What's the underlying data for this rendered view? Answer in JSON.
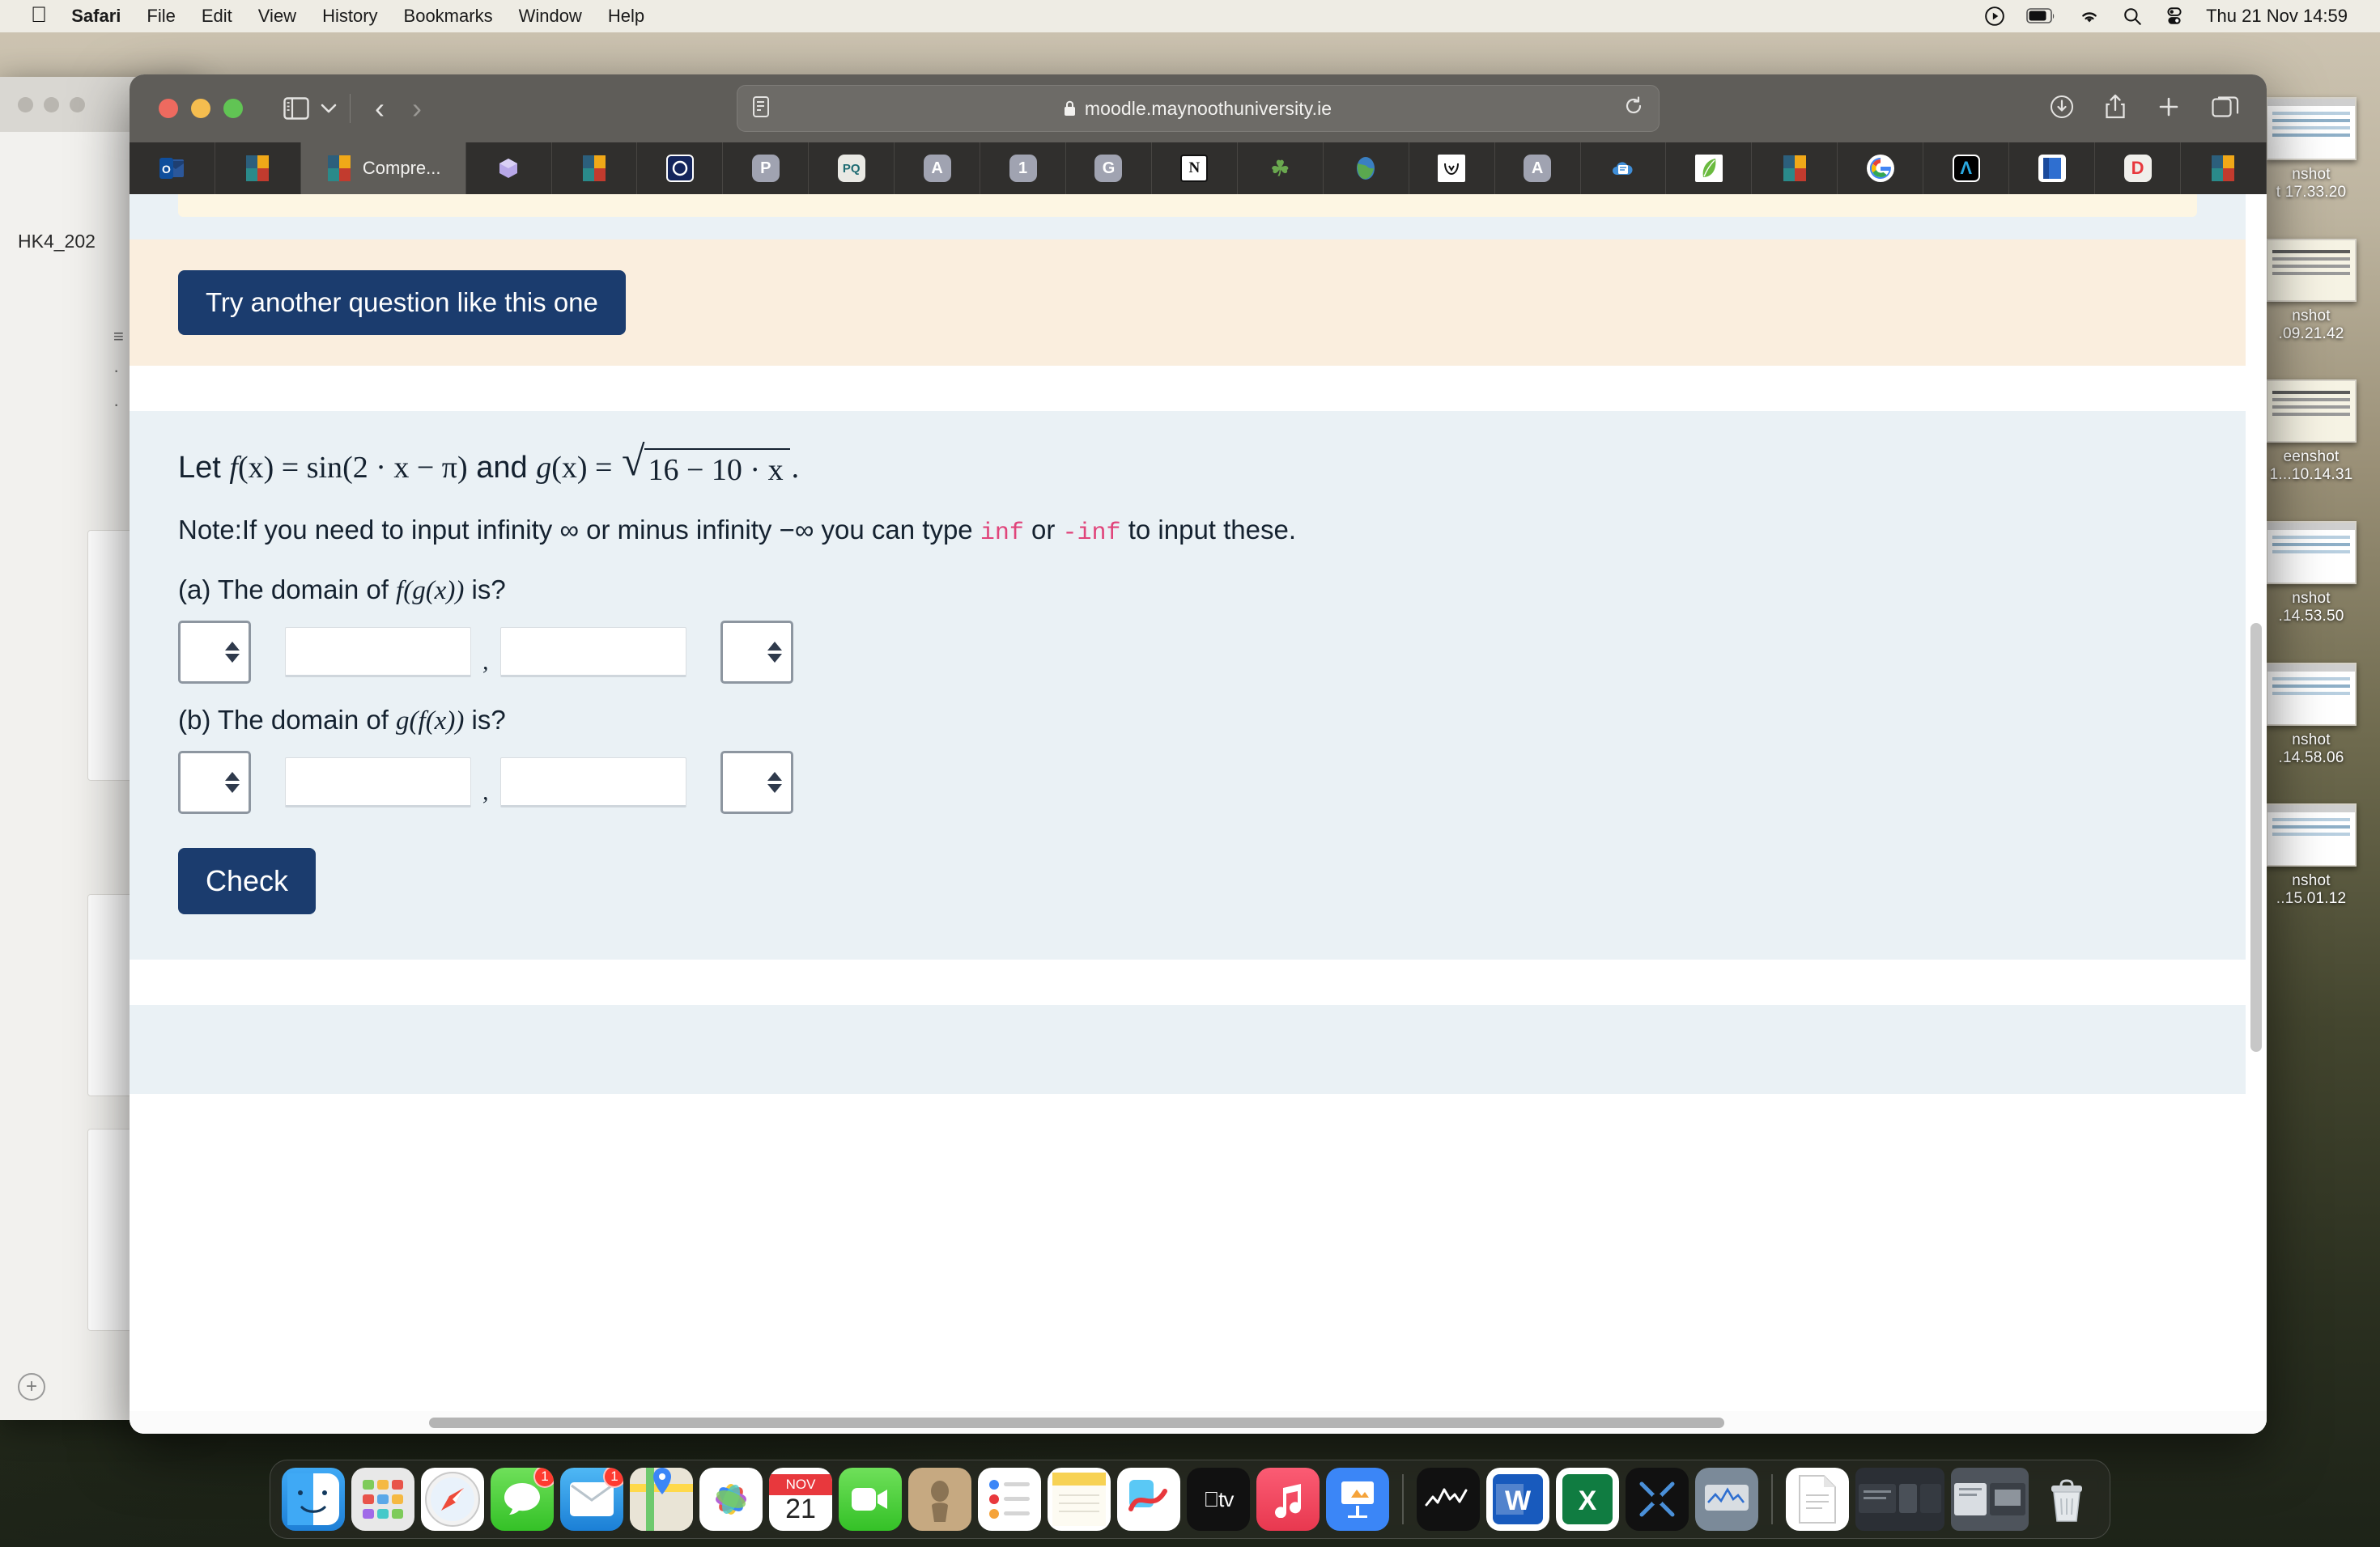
{
  "menubar": {
    "apple": "apple-logo",
    "items": [
      {
        "label": "Safari",
        "bold": true
      },
      {
        "label": "File"
      },
      {
        "label": "Edit"
      },
      {
        "label": "View"
      },
      {
        "label": "History"
      },
      {
        "label": "Bookmarks"
      },
      {
        "label": "Window"
      },
      {
        "label": "Help"
      }
    ],
    "status_icons": [
      "play-circle-icon",
      "battery-icon",
      "wifi-icon",
      "search-icon",
      "control-center-icon"
    ],
    "clock": "Thu 21 Nov  14:59"
  },
  "safari": {
    "toolbar": {
      "sidebar_icon": "sidebar-icon",
      "sidebar_chevron": "chevron-down-icon",
      "back_icon": "chevron-left-icon",
      "forward_icon": "chevron-right-icon",
      "reader_icon": "reader-view-icon",
      "lock_icon": "lock-icon",
      "url": "moodle.maynoothuniversity.ie",
      "reload_icon": "reload-icon",
      "download_icon": "download-icon",
      "share_icon": "share-icon",
      "new_tab_icon": "plus-icon",
      "tab_overview_icon": "tab-overview-icon"
    },
    "tabs": [
      {
        "favicon": "outlook-icon",
        "title": "",
        "active": false
      },
      {
        "favicon": "moodle-icon",
        "title": "",
        "active": false
      },
      {
        "favicon": "moodle-icon",
        "title": "Compre...",
        "active": true
      },
      {
        "favicon": "onedrive-icon",
        "title": "",
        "active": false
      },
      {
        "favicon": "moodle-icon",
        "title": "",
        "active": false
      },
      {
        "favicon": "openathens-icon",
        "title": "",
        "active": false
      },
      {
        "favicon": "letter-p-icon",
        "title": "",
        "active": false
      },
      {
        "favicon": "proquest-icon",
        "title": "",
        "active": false
      },
      {
        "favicon": "letter-a-icon",
        "title": "",
        "active": false
      },
      {
        "favicon": "number-one-icon",
        "title": "",
        "active": false
      },
      {
        "favicon": "letter-g-icon",
        "title": "",
        "active": false
      },
      {
        "favicon": "notion-icon",
        "title": "",
        "active": false
      },
      {
        "favicon": "clover-icon",
        "title": "",
        "active": false
      },
      {
        "favicon": "globe-icon",
        "title": "",
        "active": false
      },
      {
        "favicon": "vee-icon",
        "title": "",
        "active": false
      },
      {
        "favicon": "letter-a-grey-icon",
        "title": "",
        "active": false
      },
      {
        "favicon": "document-cloud-icon",
        "title": "",
        "active": false
      },
      {
        "favicon": "leaf-icon",
        "title": "",
        "active": false
      },
      {
        "favicon": "moodle-icon",
        "title": "",
        "active": false
      },
      {
        "favicon": "google-icon",
        "title": "",
        "active": false
      },
      {
        "favicon": "lambda-icon",
        "title": "",
        "active": false
      },
      {
        "favicon": "blue-book-icon",
        "title": "",
        "active": false
      },
      {
        "favicon": "letter-d-icon",
        "title": "",
        "active": false
      },
      {
        "favicon": "moodle-icon",
        "title": "",
        "active": false
      }
    ]
  },
  "content": {
    "try_another_button": "Try another question like this one",
    "question": {
      "let_prefix": "Let",
      "f_def": "f(x) = sin(2 · x − π)",
      "and_word": "and",
      "g_def_prefix": "g(x) =",
      "g_radicand": "16 − 10 · x",
      "g_period": ".",
      "f_name": "f",
      "f_args": "(x)",
      "equals": "=",
      "sin_word": "sin",
      "f_body": "(2 · x − π)",
      "g_name": "g",
      "g_args": "(x)",
      "note_part1": "Note:If you need to input infinity ∞ or minus infinity −∞ you can type",
      "note_code1": "inf",
      "note_or": "or",
      "note_code2": "-inf",
      "note_part2": "to input these.",
      "part_a_prefix": "(a) The domain of",
      "part_a_fn": "f(g(x))",
      "part_a_suffix": "is?",
      "part_b_prefix": "(b) The domain of",
      "part_b_fn": "g(f(x))",
      "part_b_suffix": "is?",
      "bracket_open_value": "",
      "bracket_close_value": "",
      "bracket_options": [
        "",
        "(",
        "["
      ],
      "bracket_close_options": [
        "",
        ")",
        "]"
      ],
      "lower_bound_a": "",
      "upper_bound_a": "",
      "lower_bound_b": "",
      "upper_bound_b": "",
      "separator": ",",
      "check_button": "Check"
    }
  },
  "desktop_files": [
    {
      "label_line1": "nshot",
      "label_line2": "t 17.33.20"
    },
    {
      "label_line1": "nshot",
      "label_line2": ".09.21.42"
    },
    {
      "label_line1": "eenshot",
      "label_line2": "1...10.14.31"
    },
    {
      "label_line1": "nshot",
      "label_line2": ".14.53.50"
    },
    {
      "label_line1": "nshot",
      "label_line2": ".14.58.06"
    },
    {
      "label_line1": "nshot",
      "label_line2": "..15.01.12"
    }
  ],
  "bg_window": {
    "tag": "HK4_202"
  },
  "dock": {
    "items": [
      {
        "name": "finder",
        "badge": null
      },
      {
        "name": "launchpad",
        "badge": null
      },
      {
        "name": "safari",
        "badge": null
      },
      {
        "name": "messages",
        "badge": "1"
      },
      {
        "name": "mail",
        "badge": "1"
      },
      {
        "name": "maps",
        "badge": null
      },
      {
        "name": "photos",
        "badge": null
      },
      {
        "name": "calendar",
        "badge": null,
        "month": "NOV",
        "day": "21"
      },
      {
        "name": "facetime",
        "badge": null
      },
      {
        "name": "podcasts",
        "badge": null
      },
      {
        "name": "reminders",
        "badge": null
      },
      {
        "name": "notes",
        "badge": null
      },
      {
        "name": "freeform",
        "badge": null
      },
      {
        "name": "apple-tv",
        "badge": null
      },
      {
        "name": "music",
        "badge": null
      },
      {
        "name": "keynote",
        "badge": null
      },
      {
        "name": "numbers",
        "badge": null
      },
      {
        "name": "pages",
        "badge": null
      },
      {
        "name": "stocks",
        "badge": null
      },
      {
        "name": "word",
        "badge": null
      },
      {
        "name": "excel",
        "badge": null
      },
      {
        "name": "zoom",
        "badge": null
      },
      {
        "name": "activity-monitor",
        "badge": null
      },
      {
        "name": "documents-folder",
        "badge": null
      },
      {
        "name": "downloads-folder",
        "badge": null
      },
      {
        "name": "trash",
        "badge": null
      }
    ]
  },
  "colors": {
    "accent_blue": "#1b3c6e",
    "card_blue": "#eaf1f5",
    "card_orange": "#faeede",
    "code_pink": "#e0457b"
  }
}
